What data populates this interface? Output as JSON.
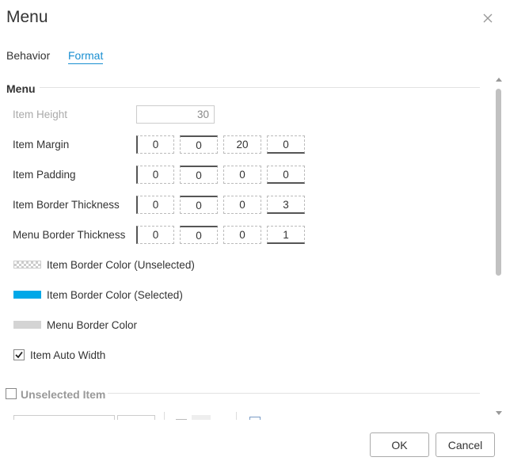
{
  "dialog": {
    "title": "Menu"
  },
  "tabs": [
    {
      "label": "Behavior"
    },
    {
      "label": "Format"
    }
  ],
  "menu_section": {
    "title": "Menu",
    "item_height": {
      "label": "Item Height",
      "value": "30"
    },
    "item_margin": {
      "label": "Item Margin",
      "values": [
        "0",
        "0",
        "20",
        "0"
      ]
    },
    "item_padding": {
      "label": "Item Padding",
      "values": [
        "0",
        "0",
        "0",
        "0"
      ]
    },
    "item_border_thickness": {
      "label": "Item Border Thickness",
      "values": [
        "0",
        "0",
        "0",
        "3"
      ]
    },
    "menu_border_thickness": {
      "label": "Menu Border Thickness",
      "values": [
        "0",
        "0",
        "0",
        "1"
      ]
    },
    "item_border_color_unselected": {
      "label": "Item Border Color (Unselected)",
      "color": "transparent"
    },
    "item_border_color_selected": {
      "label": "Item Border Color (Selected)",
      "color": "#00a8e8"
    },
    "menu_border_color": {
      "label": "Menu Border Color",
      "color": "#d4d4d4"
    },
    "item_auto_width": {
      "label": "Item Auto Width",
      "checked": true
    }
  },
  "unselected_item_section": {
    "title": "Unselected Item",
    "checked": false
  },
  "footer": {
    "ok_label": "OK",
    "cancel_label": "Cancel"
  },
  "colors": {
    "accent": "#1a8fd1"
  }
}
